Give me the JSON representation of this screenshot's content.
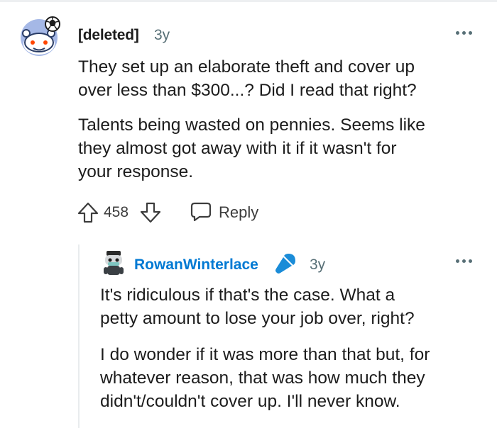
{
  "comment": {
    "author": "[deleted]",
    "age": "3y",
    "paragraphs": [
      [
        "They set up an elaborate theft and cover up",
        "over less than $300...? Did I read that right?"
      ],
      [
        "Talents being wasted on pennies. Seems like",
        "they almost got away with it if it wasn't for",
        "your response."
      ]
    ],
    "score": "458",
    "reply_label": "Reply",
    "avatar_icon": "snoo-avatar-icon",
    "more_icon": "more-options-icon"
  },
  "reply": {
    "author": "RowanWinterlace",
    "age": "3y",
    "flair_icon": "microphone-icon",
    "author_color": "#0079d3",
    "paragraphs": [
      [
        "It's ridiculous if that's the case. What a",
        "petty amount to lose your job over, right?"
      ],
      [
        "I do wonder if it was more than that but, for",
        "whatever reason, that was how much they",
        "didn't/couldn't cover up. I'll never know."
      ]
    ]
  },
  "colors": {
    "meta": "#576f76",
    "text": "#1c1c1c",
    "accent": "#0079d3",
    "mic": "#1a8cd8"
  }
}
